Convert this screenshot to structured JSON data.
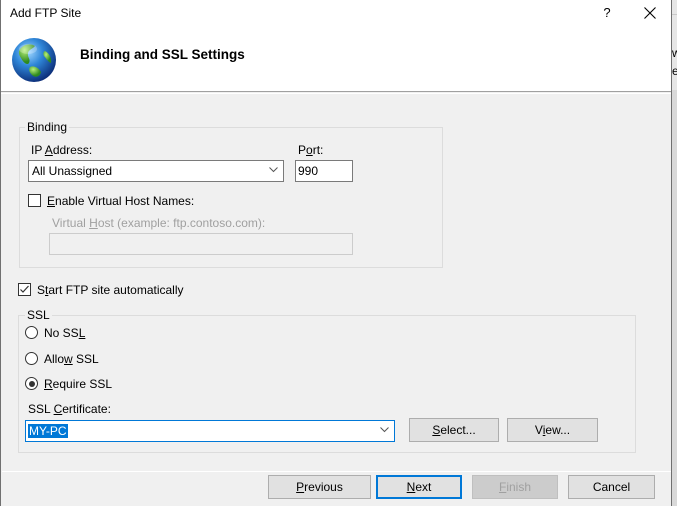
{
  "window": {
    "title": "Add FTP Site",
    "help_label": "?",
    "heading": "Binding and SSL Settings",
    "icon": "globe-icon"
  },
  "background_window": {
    "text_line1": "w",
    "text_line2": "e"
  },
  "binding": {
    "group_label": "Binding",
    "ip_address_label": "IP Address:",
    "ip_address_value": "All Unassigned",
    "port_label": "Port:",
    "port_value": "990",
    "enable_virtual_host_label": "Enable Virtual Host Names:",
    "enable_virtual_host_checked": false,
    "virtual_host_label": "Virtual Host (example: ftp.contoso.com):",
    "virtual_host_value": ""
  },
  "start_automatically": {
    "label": "Start FTP site automatically",
    "checked": true
  },
  "ssl": {
    "group_label": "SSL",
    "options": [
      {
        "label": "No SSL",
        "selected": false
      },
      {
        "label": "Allow SSL",
        "selected": false
      },
      {
        "label": "Require SSL",
        "selected": true
      }
    ],
    "certificate_label": "SSL Certificate:",
    "certificate_value": "MY-PC",
    "select_button": "Select...",
    "view_button": "View..."
  },
  "footer": {
    "previous": "Previous",
    "next": "Next",
    "finish": "Finish",
    "cancel": "Cancel"
  },
  "colors": {
    "accent": "#0078d7",
    "dialog_bg": "#f0f0f0",
    "header_bg": "#ffffff",
    "disabled_text": "#a0a0a0"
  }
}
